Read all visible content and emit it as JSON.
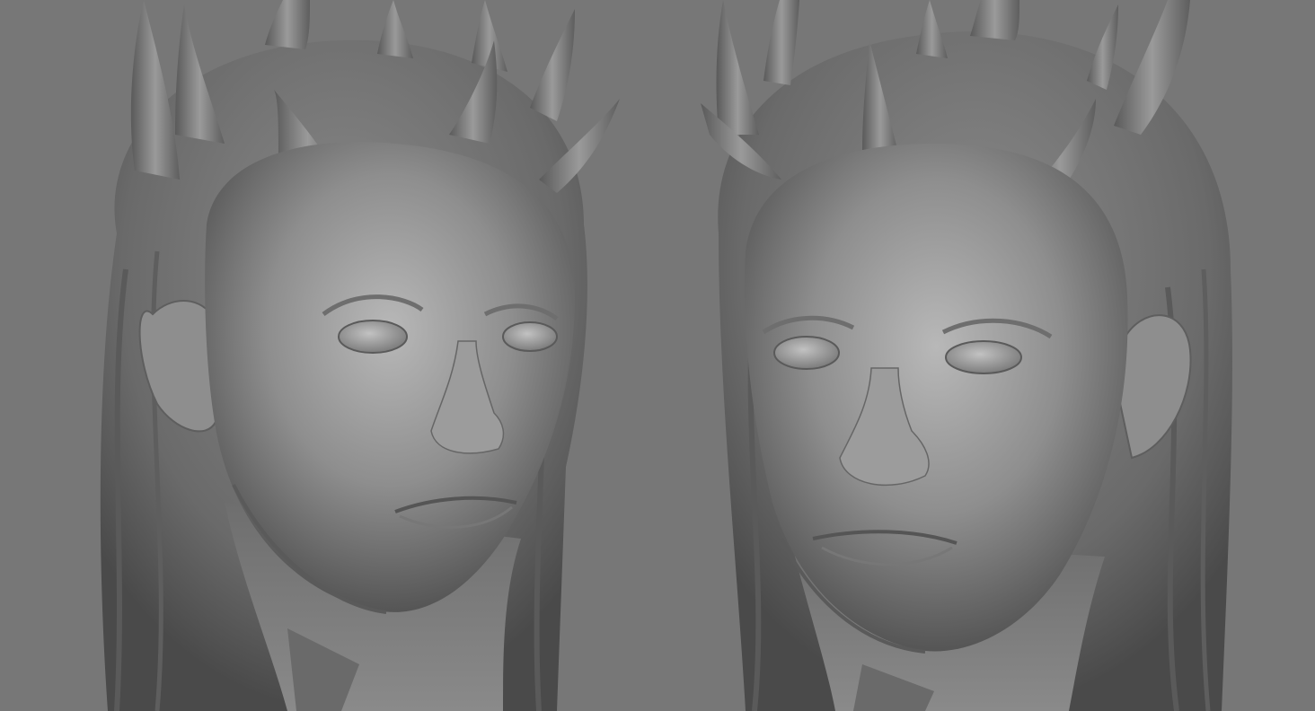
{
  "viewport": {
    "background_color": "#777777",
    "views": [
      {
        "name": "head-sculpt-left-view",
        "facing": "three-quarter-right"
      },
      {
        "name": "head-sculpt-right-view",
        "facing": "three-quarter-left"
      }
    ]
  },
  "colors": {
    "clay_base": "#8c8c8c",
    "clay_light": "#b4b4b4",
    "clay_shadow": "#4a4a4a"
  }
}
